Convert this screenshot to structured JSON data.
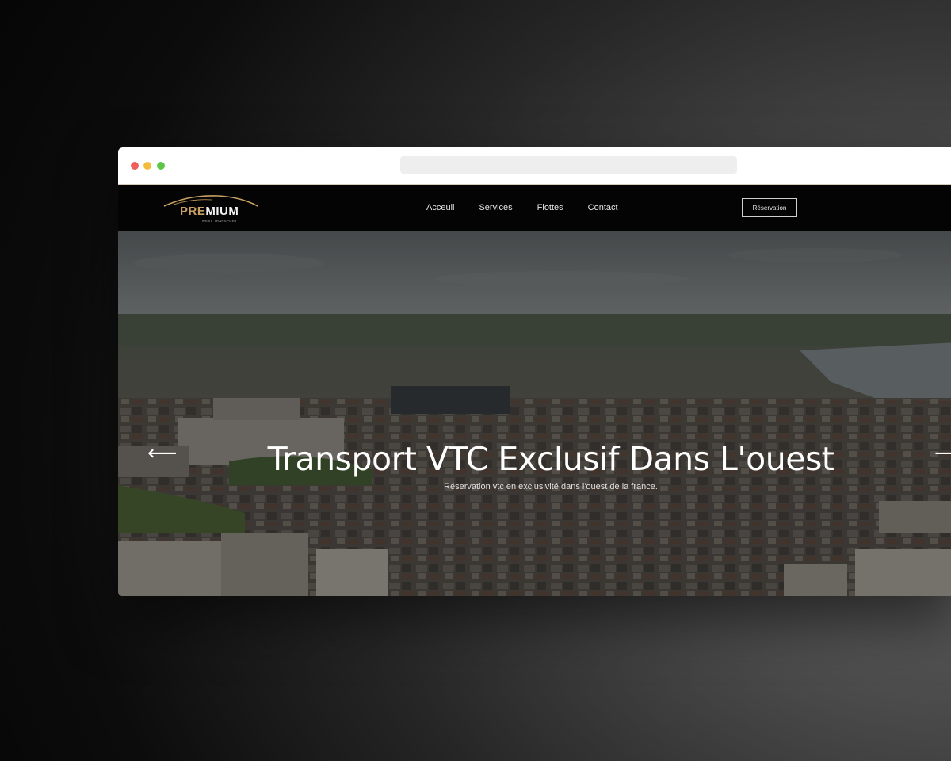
{
  "browser": {
    "address_bar": ""
  },
  "header": {
    "logo": {
      "word_pre": "PRE",
      "word_rest": "MIUM",
      "tagline": "WEST TRANSPORT"
    },
    "nav": [
      {
        "label": "Acceuil"
      },
      {
        "label": "Services"
      },
      {
        "label": "Flottes"
      },
      {
        "label": "Contact"
      }
    ],
    "cta_label": "Réservation"
  },
  "hero": {
    "title": "Transport VTC Exclusif Dans L'ouest",
    "subtitle": "Réservation vtc en exclusivité dans l'ouest de la france.",
    "prev_icon": "arrow-left-icon",
    "next_icon": "arrow-right-icon",
    "prev_glyph": "⟵",
    "next_glyph": "⟶"
  },
  "colors": {
    "brand_gold": "#c9a064",
    "navbar_bg": "#040404",
    "chrome_bg": "#ffffff"
  }
}
